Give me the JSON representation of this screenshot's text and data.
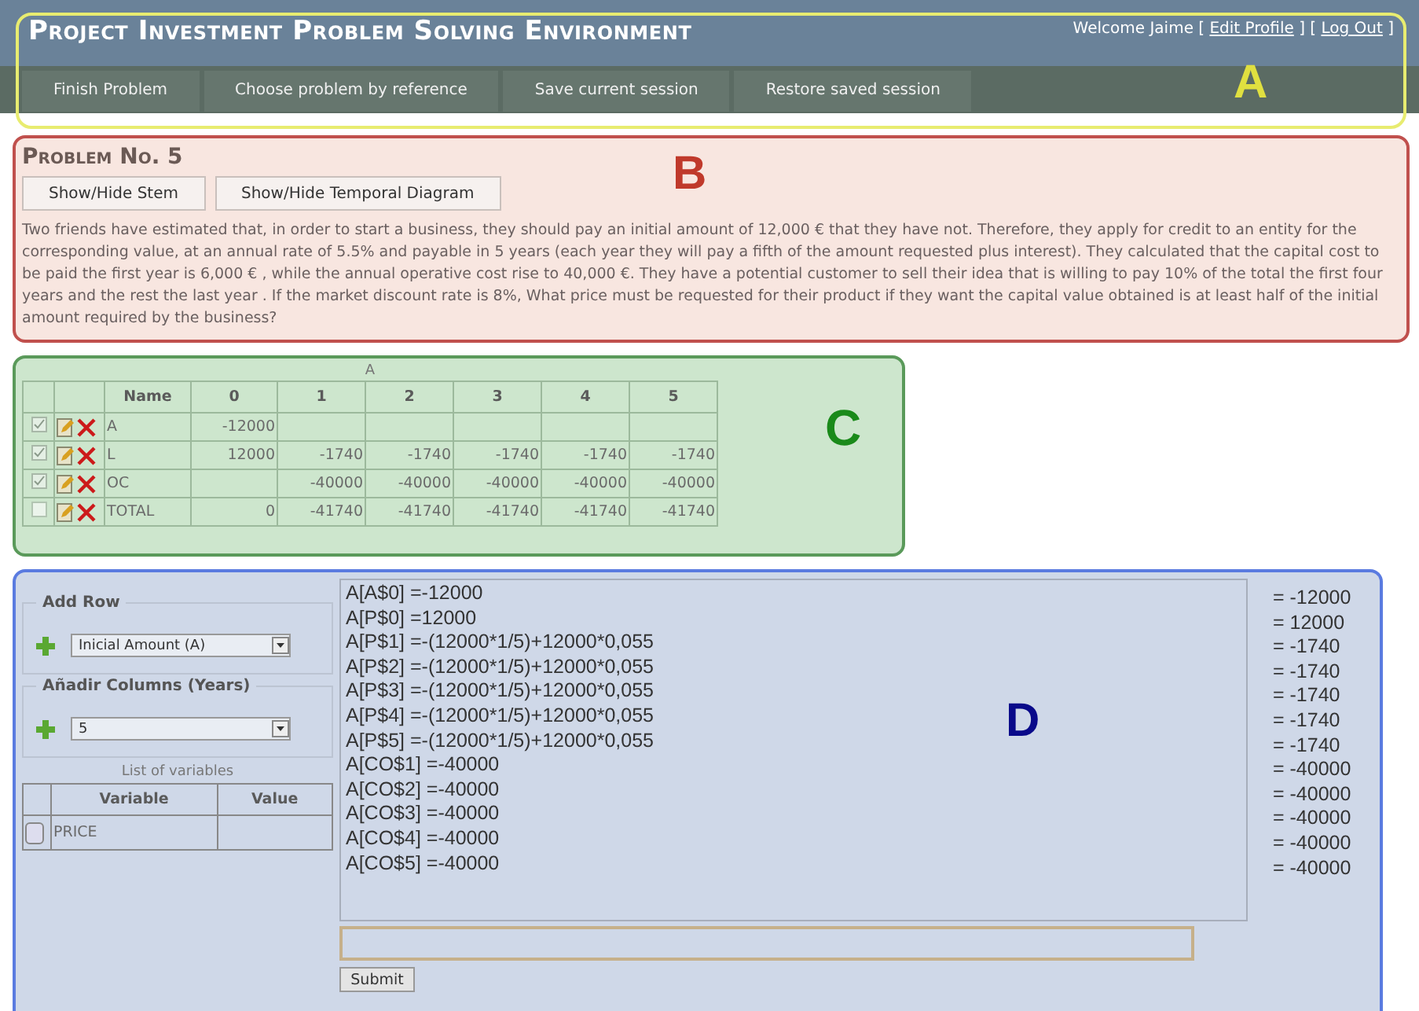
{
  "header": {
    "title": "Project Investment Problem Solving Environment",
    "user_bar": [
      {
        "kind": "text",
        "text": "Welcome Jaime ["
      },
      {
        "kind": "link",
        "text": "Edit Profile"
      },
      {
        "kind": "text",
        "text": "] ["
      },
      {
        "kind": "link",
        "text": "Log Out"
      },
      {
        "kind": "text",
        "text": "]"
      }
    ],
    "nav": [
      "Finish Problem",
      "Choose problem by reference",
      "Save current session",
      "Restore saved session"
    ],
    "section_label": "A"
  },
  "problem": {
    "title": "Problem No. 5",
    "buttons": [
      "Show/Hide Stem",
      "Show/Hide Temporal Diagram"
    ],
    "section_label": "B",
    "stem": "Two friends have estimated that, in order to start a business, they should pay an initial amount of 12,000 € that they have not. Therefore, they apply for credit to an entity for the corresponding value, at an annual rate of 5.5% and payable in 5 years (each year they will pay a fifth of the amount requested plus interest). They calculated that the capital cost to be paid the first year is 6,000 € , while the annual operative cost rise to 40,000 €. They have a potential customer to sell their idea that is willing to pay 10% of the total the first four years and the rest the last year . If the market discount rate is 8%, What price must be requested for their product if they want the capital value obtained is at least half of the initial amount required by the business?"
  },
  "cash_table": {
    "caption": "A",
    "section_label": "C",
    "columns": [
      "Name",
      "0",
      "1",
      "2",
      "3",
      "4",
      "5"
    ],
    "rows": [
      {
        "checked": true,
        "cells": [
          "A",
          "-12000",
          null,
          null,
          null,
          null,
          null
        ]
      },
      {
        "checked": true,
        "cells": [
          "L",
          "12000",
          "-1740",
          "-1740",
          "-1740",
          "-1740",
          "-1740"
        ]
      },
      {
        "checked": true,
        "cells": [
          "OC",
          null,
          "-40000",
          "-40000",
          "-40000",
          "-40000",
          "-40000"
        ]
      },
      {
        "checked": false,
        "cells": [
          "TOTAL",
          "0",
          "-41740",
          "-41740",
          "-41740",
          "-41740",
          "-41740"
        ]
      }
    ]
  },
  "workspace": {
    "section_label": "D",
    "add_row": {
      "legend": "Add Row",
      "value": "Inicial Amount (A)"
    },
    "add_columns": {
      "legend": "Añadir Columns (Years)",
      "value": "5"
    },
    "variables": {
      "caption": "List of variables",
      "columns": [
        "Variable",
        "Value"
      ],
      "rows": [
        {
          "name": "PRICE"
        }
      ]
    },
    "formulas": [
      "A[A$0] =-12000",
      "A[P$0] =12000",
      "A[P$1] =-(12000*1/5)+12000*0,055",
      "A[P$2] =-(12000*1/5)+12000*0,055",
      "A[P$3] =-(12000*1/5)+12000*0,055",
      "A[P$4] =-(12000*1/5)+12000*0,055",
      "A[P$5] =-(12000*1/5)+12000*0,055",
      "A[CO$1] =-40000",
      "A[CO$2] =-40000",
      "A[CO$3] =-40000",
      "A[CO$4] =-40000",
      "A[CO$5] =-40000"
    ],
    "results": [
      "= -12000",
      "= 12000",
      "= -1740",
      "= -1740",
      "= -1740",
      "= -1740",
      "= -1740",
      "= -40000",
      "= -40000",
      "= -40000",
      "= -40000",
      "= -40000"
    ],
    "submit": "Submit"
  }
}
